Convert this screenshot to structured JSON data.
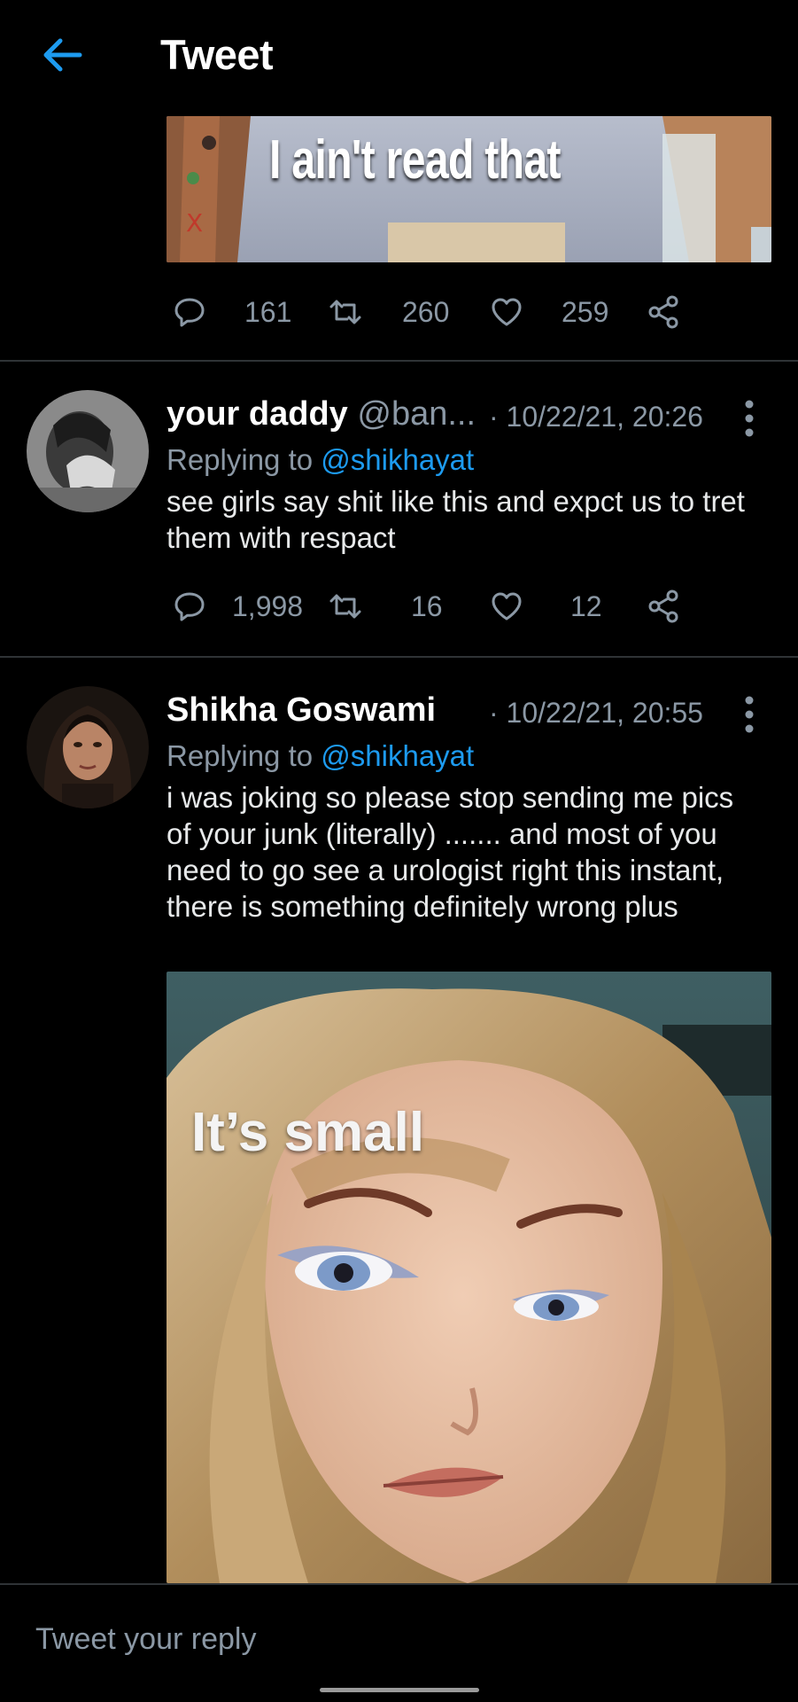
{
  "header": {
    "title": "Tweet"
  },
  "top_tweet": {
    "media_caption": "I ain't read that",
    "replies": "161",
    "retweets": "260",
    "likes": "259"
  },
  "tweets": [
    {
      "display_name": "your daddy",
      "handle": "@ban...",
      "timestamp": "· 10/22/21, 20:26",
      "replying_prefix": "Replying to",
      "replying_to": "@shikhayat",
      "text": "see girls say shit like this and expct us to tret them with respact",
      "replies": "1,998",
      "retweets": "16",
      "likes": "12"
    },
    {
      "display_name": "Shikha Goswami",
      "handle": "",
      "timestamp": "· 10/22/21, 20:55",
      "replying_prefix": "Replying to",
      "replying_to": "@shikhayat",
      "text": "i was joking so please stop sending me pics of your junk (literally) ....... and most of you need to go see a urologist right this instant, there is something definitely wrong plus",
      "media_caption": "It’s small"
    }
  ],
  "reply_bar": {
    "placeholder": "Tweet your reply"
  },
  "colors": {
    "background": "#000000",
    "accent": "#1d9bf0",
    "muted": "#8b98a5",
    "divider": "#2f3336"
  }
}
